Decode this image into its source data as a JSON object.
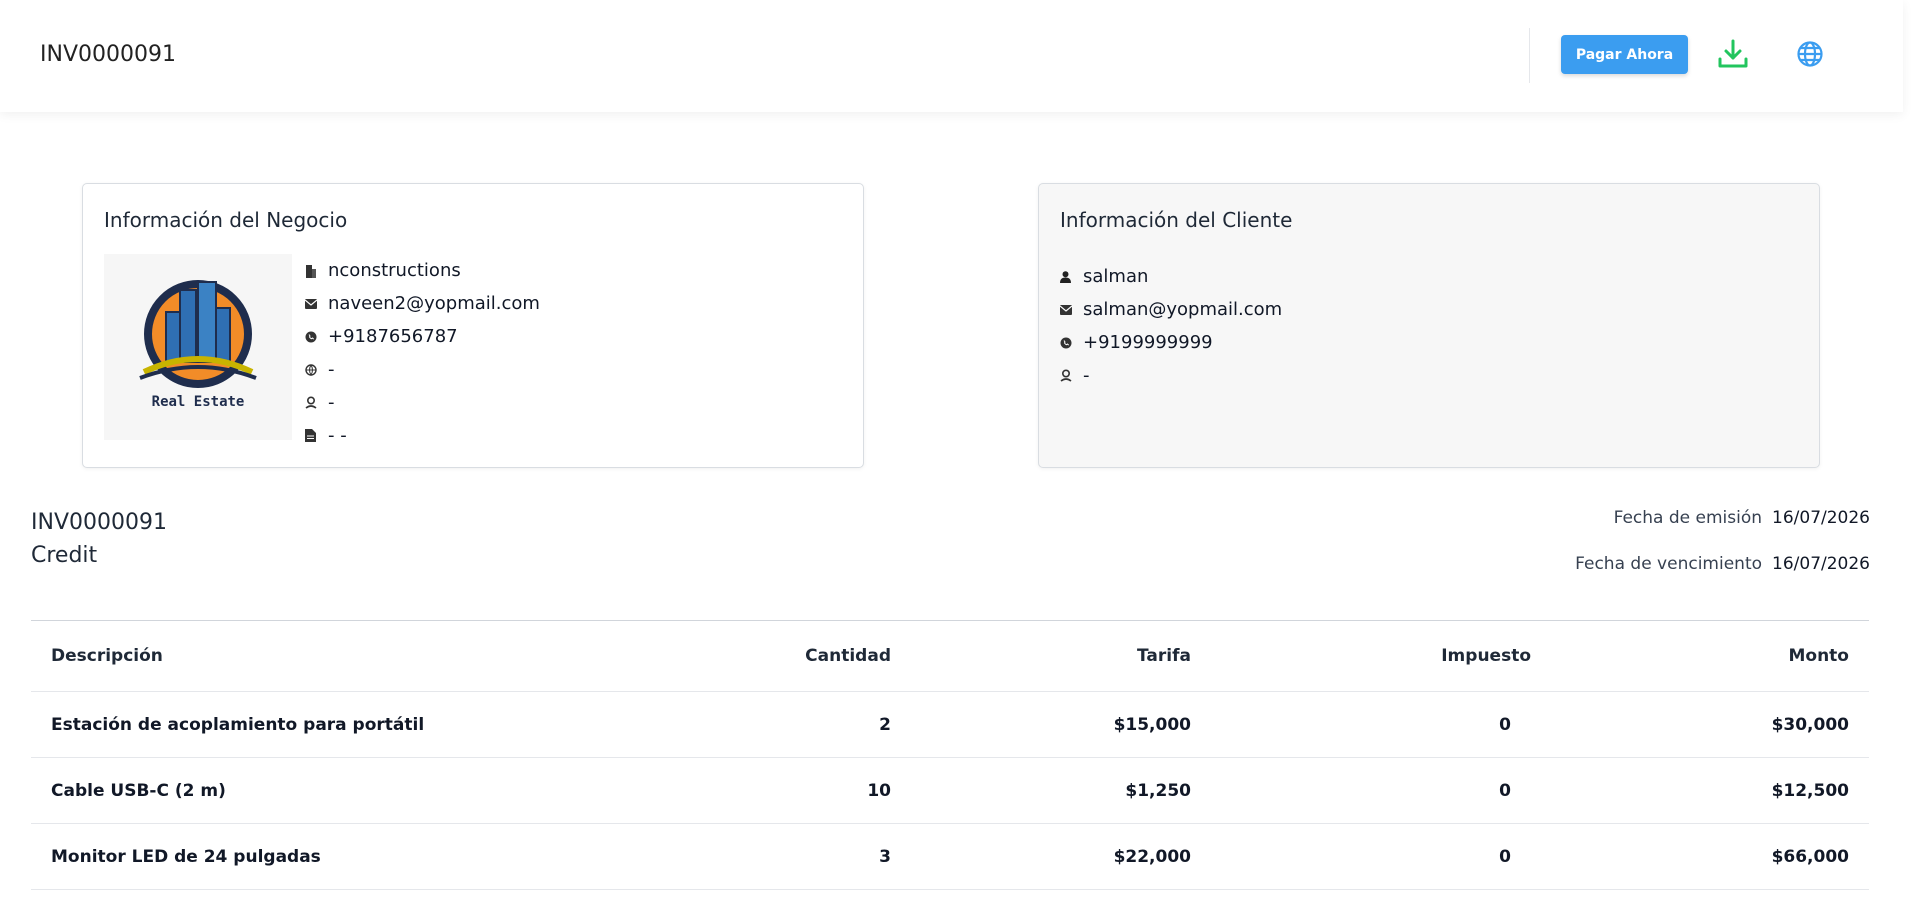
{
  "header": {
    "title": "INV0000091",
    "pay_button": "Pagar Ahora",
    "download_icon": "download-icon",
    "language_icon": "globe-icon",
    "accent": "#3b9df0",
    "download_color": "#22c55e"
  },
  "business": {
    "heading": "Información del Negocio",
    "logo_text": "Real Estate",
    "name": "nconstructions",
    "email": "naveen2@yopmail.com",
    "phone": "+9187656787",
    "website": "-",
    "address": "-",
    "tax": "- -"
  },
  "client": {
    "heading": "Información del Cliente",
    "name": "salman",
    "email": "salman@yopmail.com",
    "phone": "+9199999999",
    "address": "-"
  },
  "invoice": {
    "number": "INV0000091",
    "type": "Credit",
    "issue_label": "Fecha de emisión",
    "issue_date": "16/07/2026",
    "due_label": "Fecha de vencimiento",
    "due_date": "16/07/2026"
  },
  "table": {
    "headers": [
      "Descripción",
      "Cantidad",
      "Tarifa",
      "Impuesto",
      "Monto"
    ],
    "rows": [
      [
        "Estación de acoplamiento para portátil",
        "2",
        "$15,000",
        "0",
        "$30,000"
      ],
      [
        "Cable USB-C (2 m)",
        "10",
        "$1,250",
        "0",
        "$12,500"
      ],
      [
        "Monitor LED de 24 pulgadas",
        "3",
        "$22,000",
        "0",
        "$66,000"
      ]
    ]
  }
}
